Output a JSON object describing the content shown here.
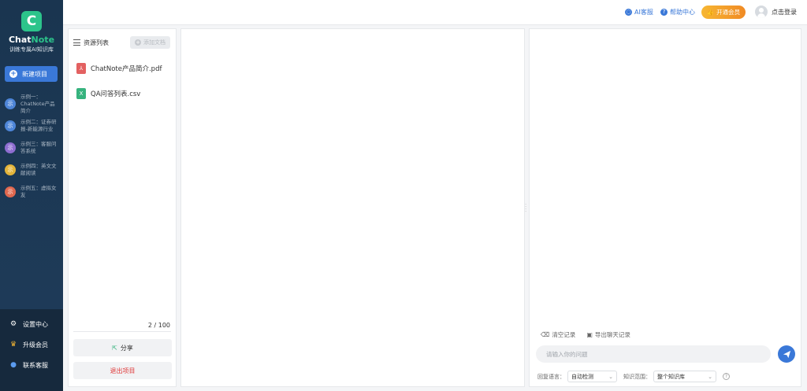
{
  "app": {
    "logo_letter": "C",
    "name_chat": "Chat",
    "name_note": "Note",
    "tagline": "训练专属AI知识库"
  },
  "sidebar": {
    "new_project_label": "新建项目",
    "examples": [
      {
        "avatar": "示",
        "label": "示例一：ChatNote产品简介",
        "color": "#4e86d9"
      },
      {
        "avatar": "示",
        "label": "示例二：证券研报-新能源行业",
        "color": "#4e86d9"
      },
      {
        "avatar": "示",
        "label": "示例三：客服问答系统",
        "color": "#8e6dd0"
      },
      {
        "avatar": "示",
        "label": "示例四：英文文献阅读",
        "color": "#e3b43a"
      },
      {
        "avatar": "示",
        "label": "示例五：虚拟女友",
        "color": "#e0684f"
      }
    ],
    "bottom": [
      {
        "label": "设置中心",
        "icon": "gear-icon"
      },
      {
        "label": "升级会员",
        "icon": "crown-icon"
      },
      {
        "label": "联系客服",
        "icon": "support-icon"
      }
    ]
  },
  "topbar": {
    "ai_service": "AI客服",
    "help_center": "帮助中心",
    "vip": "开通会员",
    "login": "点击登录"
  },
  "resources": {
    "title": "资源列表",
    "add_file": "添加文档",
    "files": [
      {
        "name": "ChatNote产品简介.pdf",
        "type": "pdf",
        "color": "#e36161",
        "glyph": "⅄"
      },
      {
        "name": "QA问答列表.csv",
        "type": "csv",
        "color": "#36b37e",
        "glyph": "X"
      }
    ],
    "count": "2 / 100",
    "share": "分享",
    "exit": "退出项目"
  },
  "chat": {
    "clear_history": "清空记录",
    "export_history": "导出聊天记录",
    "input_placeholder": "请输入你的问题",
    "reply_language_label": "回复语言：",
    "reply_language_value": "自动检测",
    "knowledge_scope_label": "知识范围：",
    "knowledge_scope_value": "整个知识库"
  },
  "colors": {
    "accent": "#3a78d8",
    "brand_green": "#2cc48b",
    "danger": "#e03a3a",
    "vip_orange": "#f08a24"
  }
}
